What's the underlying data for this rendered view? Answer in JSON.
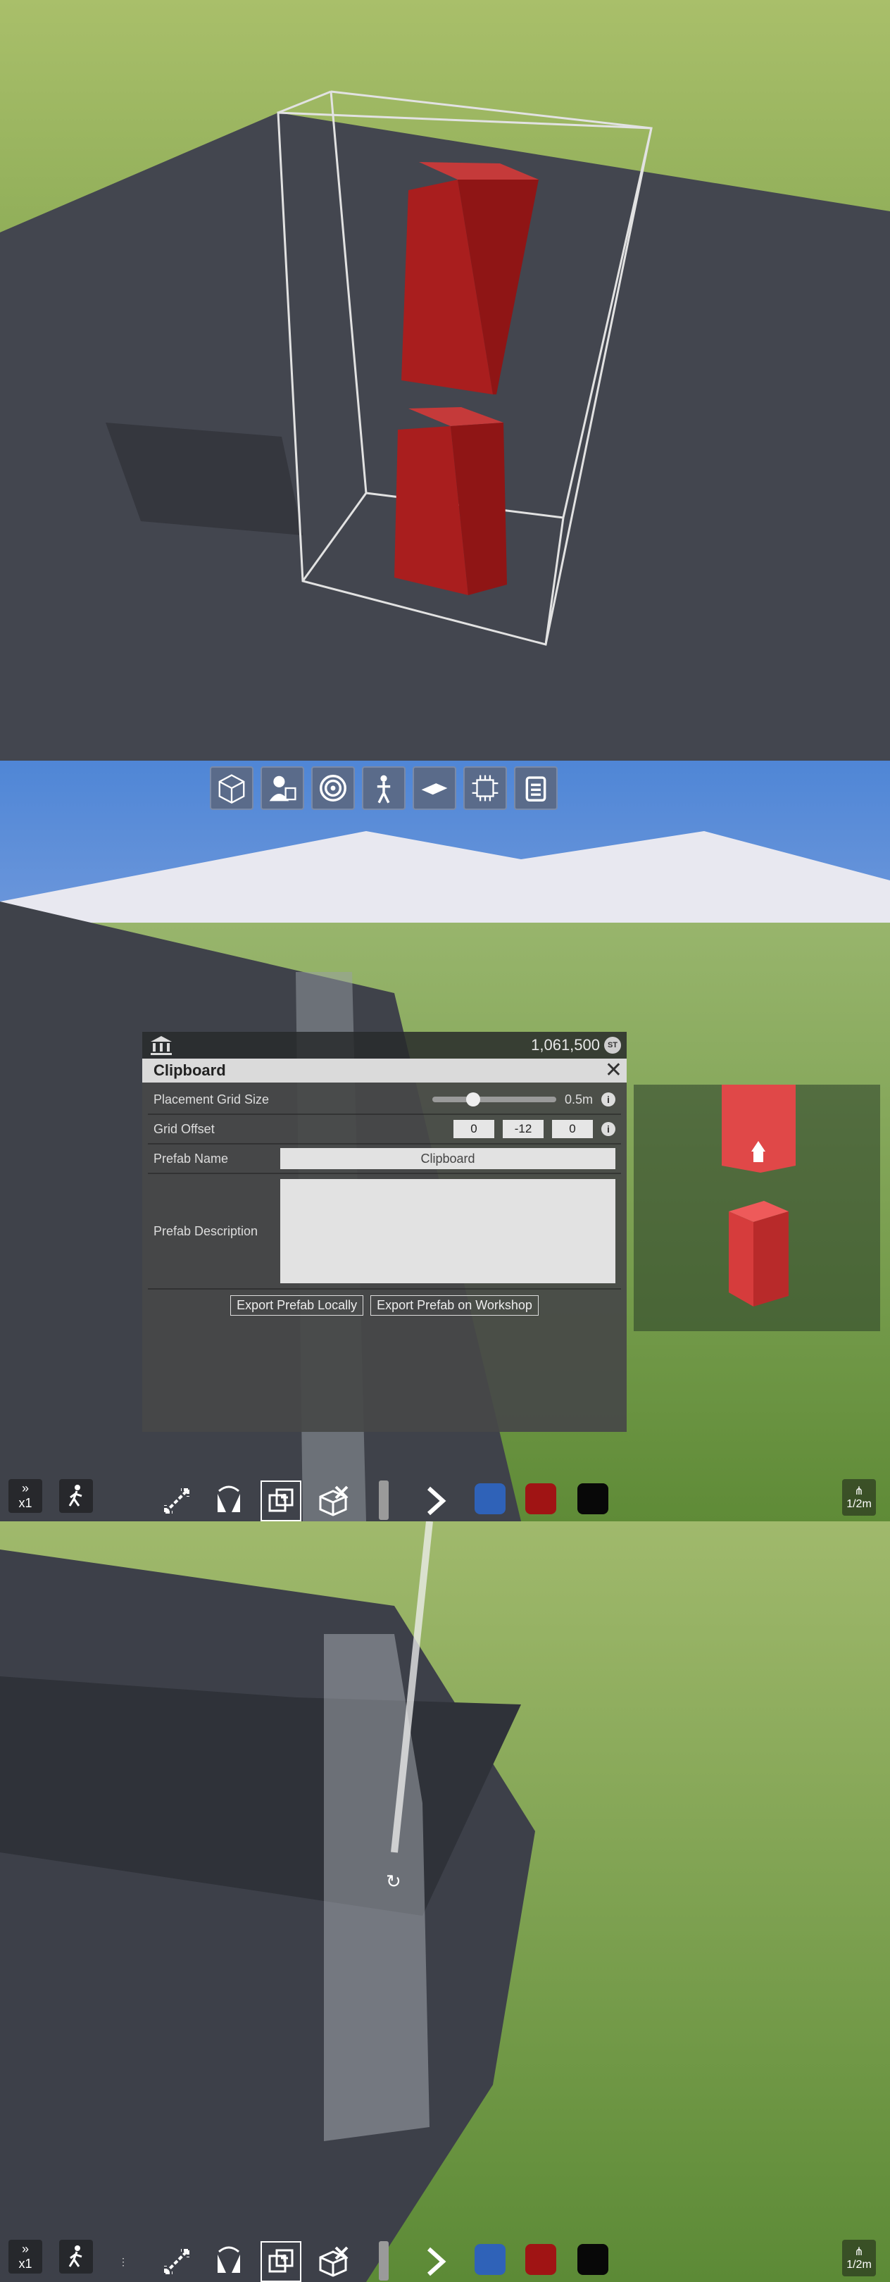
{
  "panel": {
    "currency": "1,061,500",
    "coin_label": "ST",
    "title": "Clipboard",
    "close_label": "✕",
    "rows": {
      "grid_size_label": "Placement Grid Size",
      "grid_size_value": "0.5m",
      "grid_size_level": 0.3,
      "grid_offset_label": "Grid Offset",
      "grid_offset_x": "0",
      "grid_offset_y": "-12",
      "grid_offset_z": "0",
      "prefab_name_label": "Prefab Name",
      "prefab_name_value": "Clipboard",
      "prefab_description_label": "Prefab Description",
      "prefab_description_value": ""
    },
    "buttons": {
      "export_local": "Export Prefab Locally",
      "export_workshop": "Export Prefab on Workshop"
    }
  },
  "toolbar": [
    "cube-icon",
    "character-icon",
    "target-icon",
    "rig-icon",
    "platform-icon",
    "chip-icon",
    "clipboard-icon"
  ],
  "hud": {
    "speed_label": "x1",
    "grid_label": "1/2m",
    "colors": {
      "blue": "#2f62b8",
      "red": "#a01414",
      "black": "#080808"
    }
  }
}
